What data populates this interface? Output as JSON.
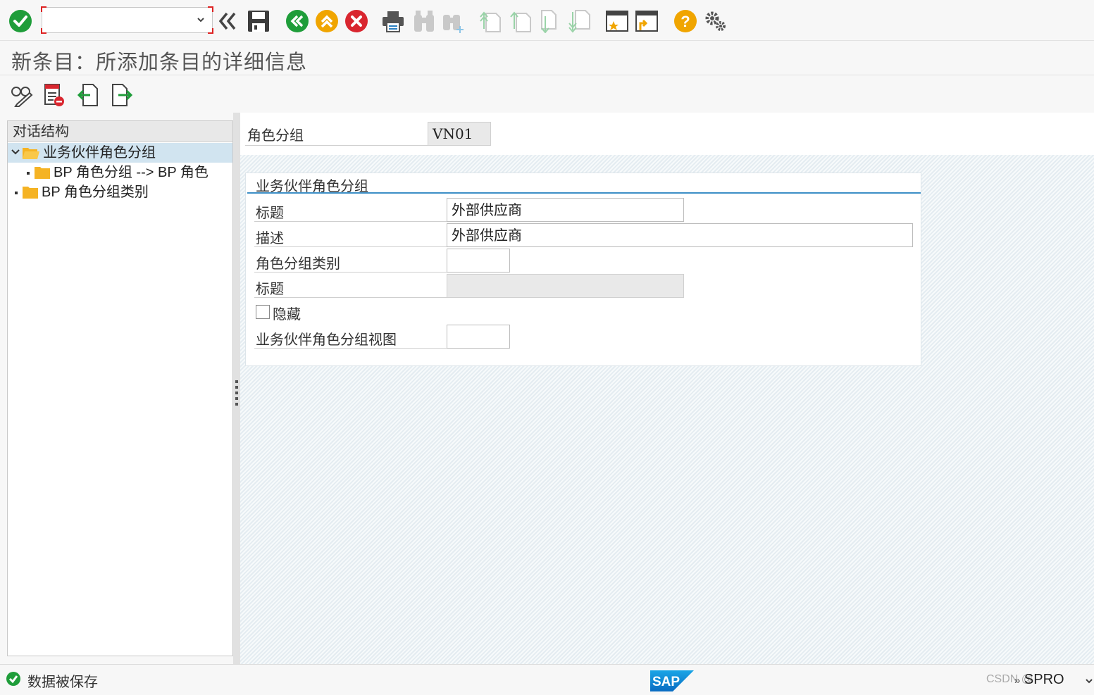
{
  "toolbar": {
    "command_placeholder": "",
    "icons": [
      "enter-check-icon",
      "double-chevron-left-icon",
      "save-icon",
      "back-icon",
      "exit-icon",
      "cancel-icon",
      "print-icon",
      "find-icon",
      "find-next-icon",
      "first-page-icon",
      "previous-page-icon",
      "next-page-icon",
      "last-page-icon",
      "create-session-icon",
      "generate-shortcut-icon",
      "help-icon",
      "settings-icon"
    ]
  },
  "title": "新条目：所添加条目的详细信息",
  "app_toolbar": {
    "icons": [
      "display-change-icon",
      "delete-entry-icon",
      "previous-entry-icon",
      "next-entry-icon"
    ]
  },
  "tree": {
    "header": "对话结构",
    "items": [
      {
        "label": "业务伙伴角色分组",
        "expanded": true,
        "selected": true
      },
      {
        "label": "BP 角色分组 --> BP 角色",
        "level": 2
      },
      {
        "label": "BP 角色分组类别"
      }
    ]
  },
  "header_field": {
    "label": "角色分组",
    "value": "VN01"
  },
  "group": {
    "title": "业务伙伴角色分组",
    "fields": [
      {
        "label": "标题",
        "value": "外部供应商"
      },
      {
        "label": "描述",
        "value": "外部供应商"
      },
      {
        "label": "角色分组类别",
        "value": ""
      },
      {
        "label": "标题",
        "value": ""
      },
      {
        "label": "隐藏",
        "checked": false
      },
      {
        "label": "业务伙伴角色分组视图",
        "value": ""
      }
    ]
  },
  "status": {
    "message": "数据被保存",
    "tcode": "SPRO",
    "watermark": "CSDN @"
  },
  "colors": {
    "accent_blue": "#3d8fc6",
    "ok_green": "#1f9d3a",
    "cancel_red": "#d9262f",
    "warn_orange": "#f0a500",
    "folder": "#f5b324"
  }
}
